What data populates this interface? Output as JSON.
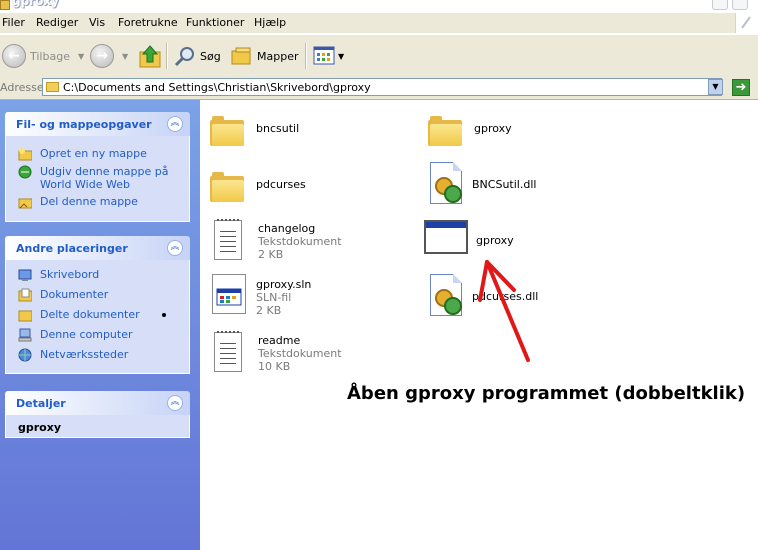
{
  "window": {
    "title": "gproxy"
  },
  "menu": [
    "Filer",
    "Rediger",
    "Vis",
    "Foretrukne",
    "Funktioner",
    "Hjælp"
  ],
  "toolbar": {
    "back": "Tilbage",
    "search": "Søg",
    "folders": "Mapper"
  },
  "address": {
    "label": "Adresse",
    "path": "C:\\Documents and Settings\\Christian\\Skrivebord\\gproxy"
  },
  "tasks": {
    "title": "Fil- og mappeopgaver",
    "items": [
      "Opret en ny mappe",
      "Udgiv denne mappe på World Wide Web",
      "Del denne mappe"
    ]
  },
  "places": {
    "title": "Andre placeringer",
    "items": [
      "Skrivebord",
      "Dokumenter",
      "Delte dokumenter",
      "Denne computer",
      "Netværkssteder"
    ]
  },
  "details": {
    "title": "Detaljer",
    "name": "gproxy"
  },
  "files": [
    {
      "name": "bncsutil",
      "type": "",
      "size": "",
      "icon": "folder-icon"
    },
    {
      "name": "gproxy",
      "type": "",
      "size": "",
      "icon": "folder-icon"
    },
    {
      "name": "pdcurses",
      "type": "",
      "size": "",
      "icon": "folder-icon"
    },
    {
      "name": "BNCSutil.dll",
      "type": "",
      "size": "",
      "icon": "dll-icon"
    },
    {
      "name": "changelog",
      "type": "Tekstdokument",
      "size": "2 KB",
      "icon": "text-document-icon"
    },
    {
      "name": "gproxy",
      "type": "",
      "size": "",
      "icon": "application-icon"
    },
    {
      "name": "gproxy.sln",
      "type": "SLN-fil",
      "size": "2 KB",
      "icon": "sln-file-icon"
    },
    {
      "name": "pdcurses.dll",
      "type": "",
      "size": "",
      "icon": "dll-icon"
    },
    {
      "name": "readme",
      "type": "Tekstdokument",
      "size": "10 KB",
      "icon": "text-document-icon"
    }
  ],
  "annotation": "Åben gproxy programmet (dobbeltklik)",
  "colors": {
    "accent": "#215dc6",
    "sidebar": "#7ba2e7",
    "arrow": "#e01818"
  }
}
